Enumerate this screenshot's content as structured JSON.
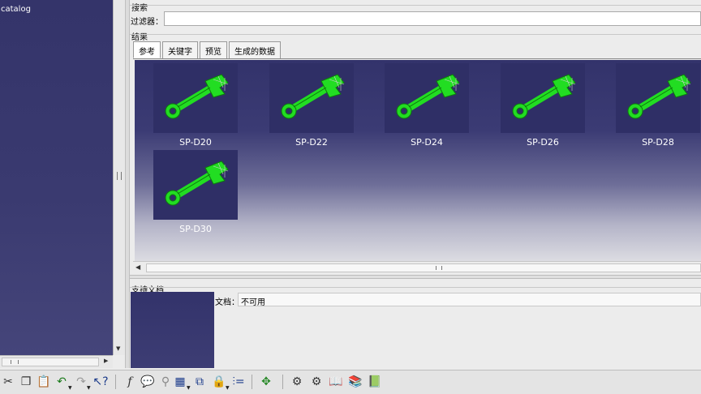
{
  "tree": {
    "root_label": "catalog"
  },
  "search": {
    "section_title": "搜索",
    "filter_label": "过滤器：",
    "filter_value": ""
  },
  "results": {
    "section_title": "结果",
    "tabs": [
      {
        "label": "参考",
        "active": true
      },
      {
        "label": "关键字",
        "active": false
      },
      {
        "label": "预览",
        "active": false
      },
      {
        "label": "生成的数据",
        "active": false
      }
    ],
    "items": [
      {
        "label": "SP-D20"
      },
      {
        "label": "SP-D22"
      },
      {
        "label": "SP-D24"
      },
      {
        "label": "SP-D26"
      },
      {
        "label": "SP-D28"
      },
      {
        "label": "SP-D30"
      }
    ]
  },
  "docs": {
    "section_title": "支持文档",
    "doc_label": "文档：",
    "doc_value": "不可用"
  },
  "toolbar": {
    "icons": [
      "cut-icon",
      "copy-icon",
      "paste-icon",
      "undo-icon",
      "redo-icon",
      "whats-this-icon",
      "formula-icon",
      "comment-icon",
      "link-icon",
      "table-icon",
      "tree-icon",
      "lock-icon",
      "parameter-icon",
      "fit-all-icon",
      "gear-icon",
      "gears-icon",
      "catalog-icon",
      "instantiate-icon",
      "publish-icon"
    ]
  },
  "colors": {
    "wrench": "#22dd22",
    "panel_bg": "#34346a"
  }
}
